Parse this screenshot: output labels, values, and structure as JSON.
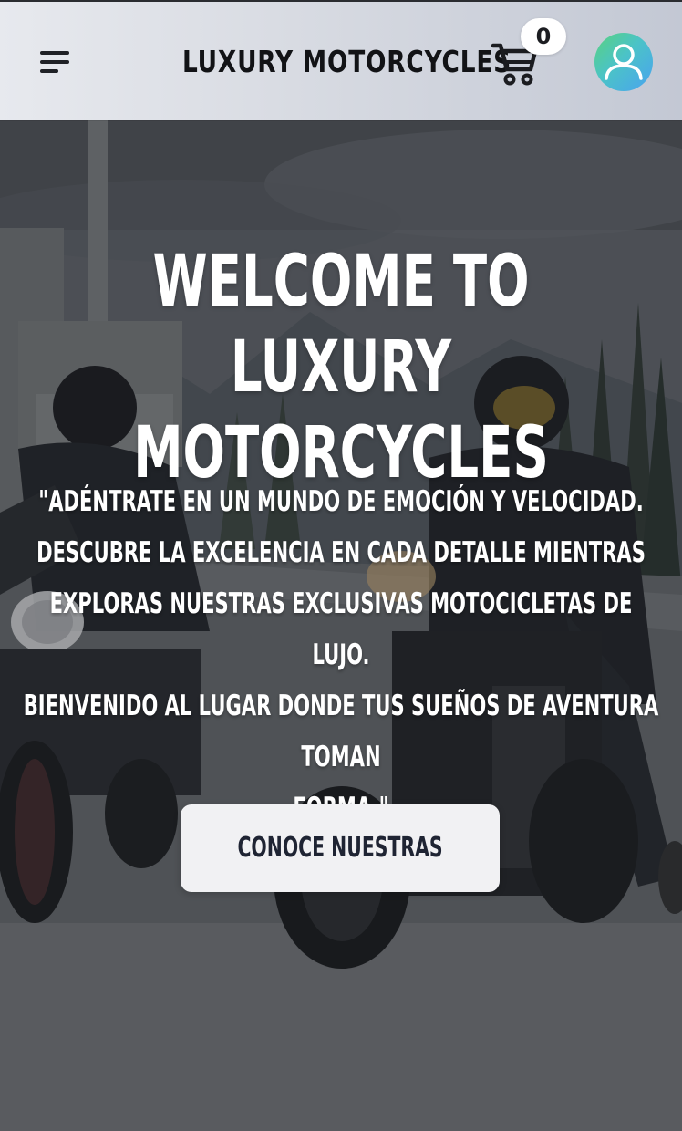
{
  "header": {
    "brand": "LUXURY MOTORCYCLES",
    "menu_icon": "hamburger-menu-icon",
    "cart_icon": "shopping-cart-icon",
    "cart_count": "0",
    "avatar_icon": "user-avatar-icon"
  },
  "hero": {
    "title_line1": "WELCOME TO LUXURY",
    "title_line2": "MOTORCYCLES",
    "text_line1": "\"ADÉNTRATE EN UN MUNDO DE EMOCIÓN Y VELOCIDAD.",
    "text_line2": "DESCUBRE LA EXCELENCIA EN CADA DETALLE MIENTRAS",
    "text_line3": "EXPLORAS NUESTRAS EXCLUSIVAS MOTOCICLETAS DE LUJO.",
    "text_line4": "BIENVENIDO AL LUGAR DONDE TUS SUEÑOS DE AVENTURA TOMAN",
    "text_line5": "FORMA.\"",
    "cta_label": "CONOCE NUESTRAS MOTOS"
  },
  "colors": {
    "header_bg": "#dfe1e7",
    "text_dark": "#121316",
    "cta_bg": "#f1f1f3",
    "cta_text": "#1f2433",
    "avatar_gradient_start": "#59d27f",
    "avatar_gradient_end": "#4aa3f0"
  }
}
